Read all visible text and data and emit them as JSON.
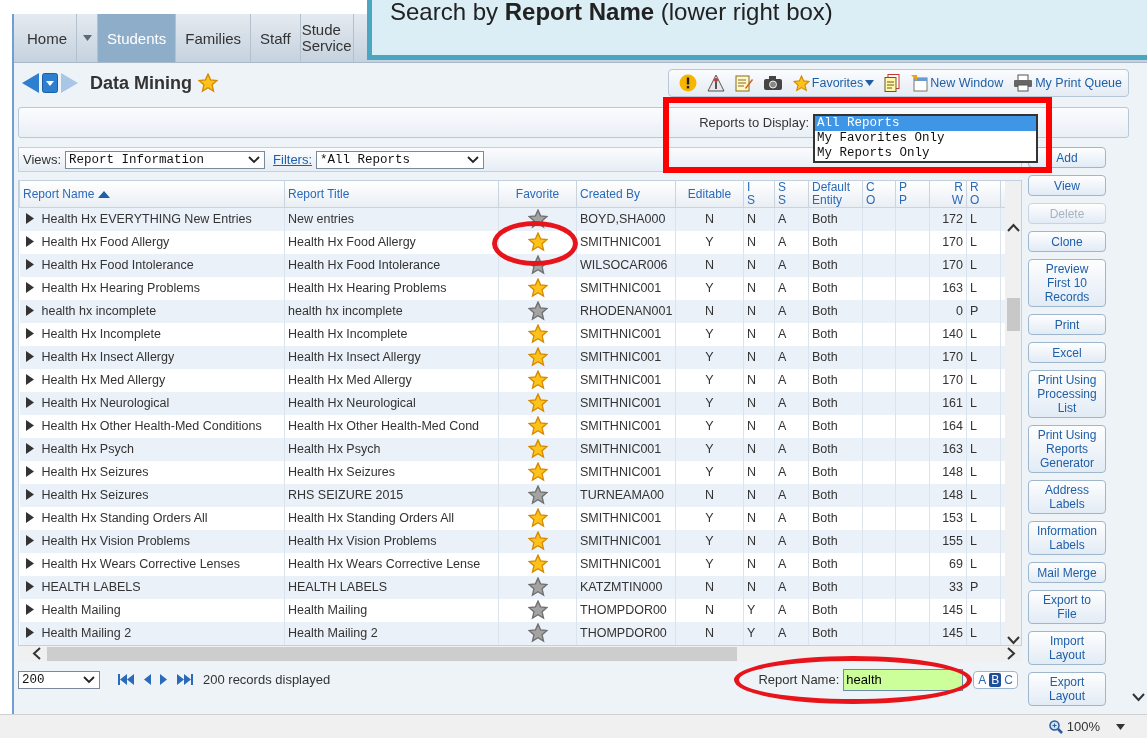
{
  "callout": {
    "text": "Search by **Report Name** (lower right box)"
  },
  "nav_tabs": [
    {
      "kind": "tab",
      "label": "Home",
      "selected": false
    },
    {
      "kind": "menu",
      "selected": false
    },
    {
      "kind": "tab",
      "label": "Students",
      "selected": true
    },
    {
      "kind": "tab",
      "label": "Families",
      "selected": false
    },
    {
      "kind": "tab",
      "label": "Staff",
      "selected": false
    },
    {
      "kind": "tab",
      "label": "Stude Service",
      "selected": false
    }
  ],
  "page": {
    "title": "Data Mining",
    "favorite": true
  },
  "toolbar": {
    "favorites": "Favorites",
    "new_window": "New Window",
    "print_queue": "My Print Queue"
  },
  "reports_to_display": {
    "label": "Reports to Display:",
    "highlighted": true,
    "options": [
      {
        "label": "All Reports",
        "selected": true
      },
      {
        "label": "My Favorites Only",
        "selected": false
      },
      {
        "label": "My Reports Only",
        "selected": false
      }
    ]
  },
  "views": {
    "label": "Views:",
    "value": "Report Information"
  },
  "filters": {
    "label": "Filters:",
    "value": "*All Reports"
  },
  "table": {
    "columns": [
      {
        "label": "Report Name",
        "sorted": true
      },
      {
        "label": "Report Title"
      },
      {
        "label": "Favorite"
      },
      {
        "label": "Created By"
      },
      {
        "label": "Editable"
      },
      {
        "label": "I S"
      },
      {
        "label": "S S"
      },
      {
        "label": "Default Entity"
      },
      {
        "label": "C O"
      },
      {
        "label": "P P"
      },
      {
        "label": "R W"
      },
      {
        "label": "R O"
      }
    ],
    "rows": [
      {
        "name": "Health Hx EVERYTHING New Entries",
        "title": "New entries",
        "favorite": false,
        "created_by": "BOYD,SHA000",
        "editable": "N",
        "is": "N",
        "ss": "A",
        "default_entity": "Both",
        "rw": "172",
        "ro": "L"
      },
      {
        "name": "Health Hx Food Allergy",
        "title": "Health Hx Food Allergy",
        "favorite": true,
        "circled": true,
        "created_by": "SMITHNIC001",
        "editable": "Y",
        "is": "N",
        "ss": "A",
        "default_entity": "Both",
        "rw": "170",
        "ro": "L"
      },
      {
        "name": "Health Hx Food Intolerance",
        "title": "Health Hx Food Intolerance",
        "favorite": false,
        "created_by": "WILSOCAR006",
        "editable": "N",
        "is": "N",
        "ss": "A",
        "default_entity": "Both",
        "rw": "170",
        "ro": "L"
      },
      {
        "name": "Health Hx Hearing Problems",
        "title": "Health Hx Hearing Problems",
        "favorite": true,
        "created_by": "SMITHNIC001",
        "editable": "Y",
        "is": "N",
        "ss": "A",
        "default_entity": "Both",
        "rw": "163",
        "ro": "L"
      },
      {
        "name": "health hx incomplete",
        "title": "health hx incomplete",
        "favorite": false,
        "created_by": "RHODENAN001",
        "editable": "N",
        "is": "N",
        "ss": "A",
        "default_entity": "Both",
        "rw": "0",
        "ro": "P"
      },
      {
        "name": "Health Hx Incomplete",
        "title": "Health Hx Incomplete",
        "favorite": true,
        "created_by": "SMITHNIC001",
        "editable": "Y",
        "is": "N",
        "ss": "A",
        "default_entity": "Both",
        "rw": "140",
        "ro": "L"
      },
      {
        "name": "Health Hx Insect Allergy",
        "title": "Health Hx Insect Allergy",
        "favorite": true,
        "created_by": "SMITHNIC001",
        "editable": "Y",
        "is": "N",
        "ss": "A",
        "default_entity": "Both",
        "rw": "170",
        "ro": "L"
      },
      {
        "name": "Health Hx Med Allergy",
        "title": "Health Hx Med Allergy",
        "favorite": true,
        "created_by": "SMITHNIC001",
        "editable": "Y",
        "is": "N",
        "ss": "A",
        "default_entity": "Both",
        "rw": "170",
        "ro": "L"
      },
      {
        "name": "Health Hx Neurological",
        "title": "Health Hx Neurological",
        "favorite": true,
        "created_by": "SMITHNIC001",
        "editable": "Y",
        "is": "N",
        "ss": "A",
        "default_entity": "Both",
        "rw": "161",
        "ro": "L"
      },
      {
        "name": "Health Hx Other Health-Med Conditions",
        "title": "Health Hx Other Health-Med Cond",
        "favorite": true,
        "created_by": "SMITHNIC001",
        "editable": "Y",
        "is": "N",
        "ss": "A",
        "default_entity": "Both",
        "rw": "164",
        "ro": "L"
      },
      {
        "name": "Health Hx Psych",
        "title": "Health Hx Psych",
        "favorite": true,
        "created_by": "SMITHNIC001",
        "editable": "Y",
        "is": "N",
        "ss": "A",
        "default_entity": "Both",
        "rw": "163",
        "ro": "L"
      },
      {
        "name": "Health Hx Seizures",
        "title": "Health Hx Seizures",
        "favorite": true,
        "created_by": "SMITHNIC001",
        "editable": "Y",
        "is": "N",
        "ss": "A",
        "default_entity": "Both",
        "rw": "148",
        "ro": "L"
      },
      {
        "name": "Health Hx Seizures",
        "title": "RHS SEIZURE 2015",
        "favorite": false,
        "created_by": "TURNEAMA00",
        "editable": "N",
        "is": "N",
        "ss": "A",
        "default_entity": "Both",
        "rw": "148",
        "ro": "L"
      },
      {
        "name": "Health Hx Standing Orders All",
        "title": "Health Hx Standing Orders All",
        "favorite": true,
        "created_by": "SMITHNIC001",
        "editable": "Y",
        "is": "N",
        "ss": "A",
        "default_entity": "Both",
        "rw": "153",
        "ro": "L"
      },
      {
        "name": "Health Hx Vision Problems",
        "title": "Health Hx Vision Problems",
        "favorite": true,
        "created_by": "SMITHNIC001",
        "editable": "Y",
        "is": "N",
        "ss": "A",
        "default_entity": "Both",
        "rw": "155",
        "ro": "L"
      },
      {
        "name": "Health Hx Wears Corrective Lenses",
        "title": "Health Hx Wears Corrective Lense",
        "favorite": true,
        "created_by": "SMITHNIC001",
        "editable": "Y",
        "is": "N",
        "ss": "A",
        "default_entity": "Both",
        "rw": "69",
        "ro": "L"
      },
      {
        "name": "HEALTH LABELS",
        "title": "HEALTH LABELS",
        "favorite": false,
        "created_by": "KATZMTIN000",
        "editable": "N",
        "is": "N",
        "ss": "A",
        "default_entity": "Both",
        "rw": "33",
        "ro": "P"
      },
      {
        "name": "Health Mailing",
        "title": "Health Mailing",
        "favorite": false,
        "created_by": "THOMPDOR00",
        "editable": "N",
        "is": "Y",
        "ss": "A",
        "default_entity": "Both",
        "rw": "145",
        "ro": "L"
      },
      {
        "name": "Health Mailing 2",
        "title": "Health Mailing 2",
        "favorite": false,
        "created_by": "THOMPDOR00",
        "editable": "N",
        "is": "Y",
        "ss": "A",
        "default_entity": "Both",
        "rw": "145",
        "ro": "L"
      }
    ]
  },
  "actions": [
    {
      "label": "Add",
      "disabled": false
    },
    {
      "label": "View",
      "disabled": false
    },
    {
      "label": "Delete",
      "disabled": true
    },
    {
      "label": "Clone",
      "disabled": false
    },
    {
      "label": "Preview First 10 Records",
      "disabled": false
    },
    {
      "label": "Print",
      "disabled": false
    },
    {
      "label": "Excel",
      "disabled": false
    },
    {
      "label": "Print Using Processing List",
      "disabled": false
    },
    {
      "label": "Print Using Reports Generator",
      "disabled": false
    },
    {
      "label": "Address Labels",
      "disabled": false
    },
    {
      "label": "Information Labels",
      "disabled": false
    },
    {
      "label": "Mail Merge",
      "disabled": false
    },
    {
      "label": "Export to File",
      "disabled": false
    },
    {
      "label": "Import Layout",
      "disabled": false
    },
    {
      "label": "Export Layout",
      "disabled": false
    }
  ],
  "footer": {
    "page_size": "200",
    "records": "200 records displayed",
    "search_label": "Report Name:",
    "search_value": "health",
    "circled": true,
    "letter_filter": [
      {
        "label": "A",
        "selected": false
      },
      {
        "label": "B",
        "selected": true
      },
      {
        "label": "C",
        "selected": false
      }
    ]
  },
  "status_bar": {
    "zoom": "100%"
  }
}
